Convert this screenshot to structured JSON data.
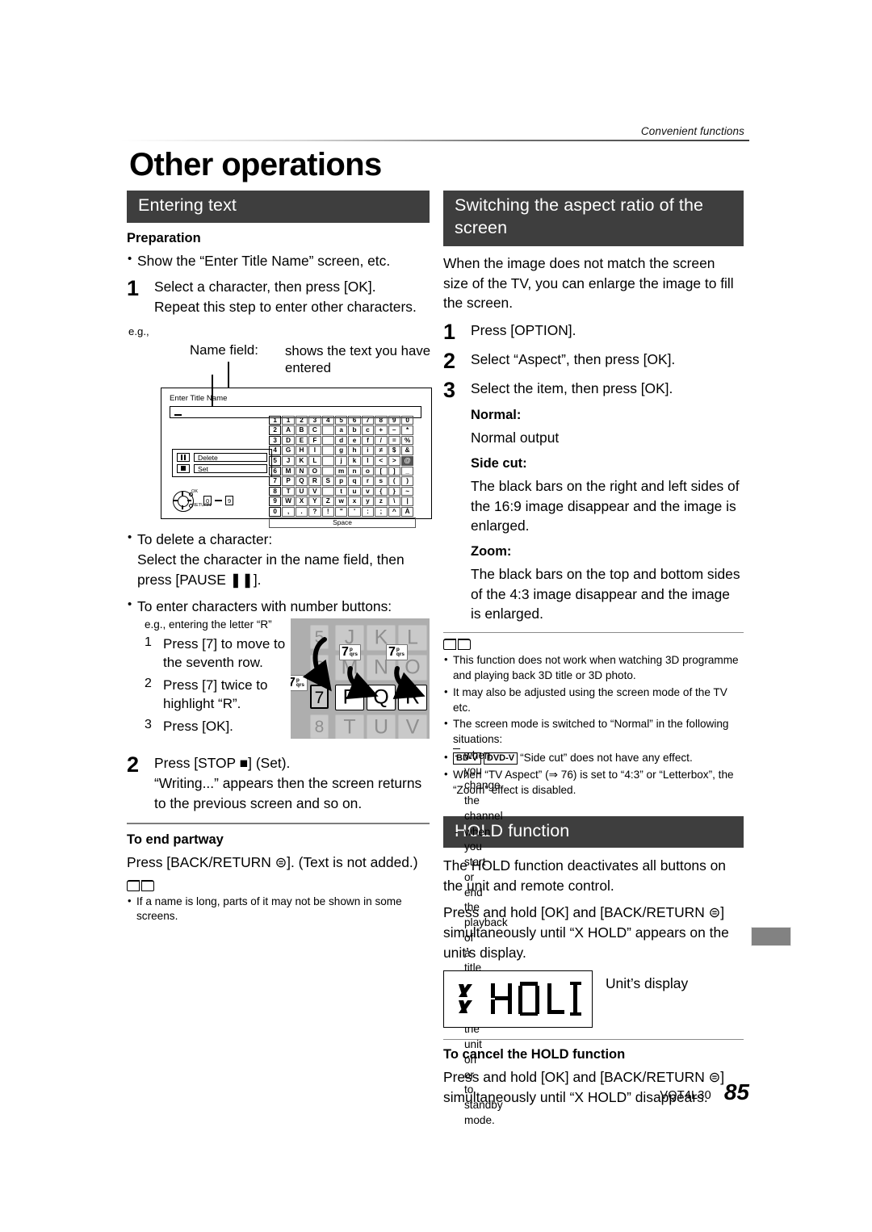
{
  "running_header": "Convenient functions",
  "page_title": "Other operations",
  "left": {
    "section_title": "Entering text",
    "preparation_heading": "Preparation",
    "preparation_items": [
      "Show the “Enter Title Name” screen, etc."
    ],
    "step1": {
      "number": "1",
      "line1": "Select a character, then press [OK].",
      "line2": "Repeat this step to enter other characters."
    },
    "eg_label": "e.g.,",
    "callout": {
      "name_field": "Name field:",
      "description": "shows the text you have entered"
    },
    "osd": {
      "title": "Enter Title Name",
      "commands": [
        {
          "icon": "pause-icon",
          "label": "Delete"
        },
        {
          "icon": "stop-icon",
          "label": "Set"
        }
      ],
      "dial_ok": "OK",
      "dial_return": "RETURN",
      "num_from": "0",
      "num_to": "9",
      "space_label": "Space",
      "grid_rows": [
        [
          "1",
          "1",
          "2",
          "3",
          "4",
          "5",
          "6",
          "7",
          "8",
          "9",
          "0"
        ],
        [
          "2",
          "A",
          "B",
          "C",
          "",
          "a",
          "b",
          "c",
          "+",
          "–",
          "*"
        ],
        [
          "3",
          "D",
          "E",
          "F",
          "",
          "d",
          "e",
          "f",
          "/",
          "=",
          "%"
        ],
        [
          "4",
          "G",
          "H",
          "I",
          "",
          "g",
          "h",
          "i",
          "≠",
          "$",
          "&"
        ],
        [
          "5",
          "J",
          "K",
          "L",
          "",
          "j",
          "k",
          "l",
          "<",
          ">",
          "@"
        ],
        [
          "6",
          "M",
          "N",
          "O",
          "",
          "m",
          "n",
          "o",
          "[",
          "]",
          "_"
        ],
        [
          "7",
          "P",
          "Q",
          "R",
          "S",
          "p",
          "q",
          "r",
          "s",
          "(",
          ")"
        ],
        [
          "8",
          "T",
          "U",
          "V",
          "",
          "t",
          "u",
          "v",
          "{",
          "}",
          "~"
        ],
        [
          "9",
          "W",
          "X",
          "Y",
          "Z",
          "w",
          "x",
          "y",
          "z",
          "\\",
          "|"
        ],
        [
          "0",
          ",",
          ".",
          "?",
          "!",
          "\"",
          "'",
          ":",
          ";",
          "^",
          "À"
        ]
      ],
      "selected_cell": {
        "row": 4,
        "col": 10
      }
    },
    "bullets": [
      {
        "heading": "To delete a character:",
        "body": "Select the character in the name field, then press [PAUSE ❚❚]."
      },
      {
        "heading": "To enter characters with number buttons:"
      }
    ],
    "eg_letter": "e.g., entering the letter “R”",
    "ministeps": [
      {
        "n": "1",
        "t": "Press [7] to move to the seventh row."
      },
      {
        "n": "2",
        "t": "Press [7] twice to highlight “R”."
      },
      {
        "n": "3",
        "t": "Press [OK]."
      }
    ],
    "keypad": {
      "rows": [
        {
          "num": "5",
          "keys": [
            "J",
            "K",
            "L"
          ]
        },
        {
          "num": "6",
          "keys": [
            "M",
            "N",
            "O"
          ]
        },
        {
          "num": "7",
          "keys": [
            "P",
            "Q",
            "R"
          ]
        },
        {
          "num": "8",
          "keys": [
            "T",
            "U",
            "V"
          ]
        }
      ],
      "highlight_row_num": "7",
      "highlight_keys": [
        "P",
        "Q",
        "R"
      ],
      "tag_digit": "7",
      "tag_sup_top": "p",
      "tag_sup_bottom": "qrs",
      "tag_count": 3
    },
    "step2": {
      "number": "2",
      "line1": "Press [STOP ■] (Set).",
      "line2": "“Writing...” appears then the screen returns to the previous screen and so on."
    },
    "end_partway": {
      "heading": "To end partway",
      "body": "Press [BACK/RETURN ⊜]. (Text is not added.)"
    },
    "notes": [
      "If a name is long, parts of it may not be shown in some screens."
    ]
  },
  "right": {
    "aspect": {
      "section_title": "Switching the aspect ratio of the screen",
      "intro": "When the image does not match the screen size of the TV, you can enlarge the image to fill the screen.",
      "steps": [
        {
          "n": "1",
          "t": "Press [OPTION]."
        },
        {
          "n": "2",
          "t": "Select “Aspect”, then press [OK]."
        },
        {
          "n": "3",
          "t": "Select the item, then press [OK]."
        }
      ],
      "items": [
        {
          "term": "Normal:",
          "desc": "Normal output"
        },
        {
          "term": "Side cut:",
          "desc": "The black bars on the right and left sides of the 16:9 image disappear and the image is enlarged."
        },
        {
          "term": "Zoom:",
          "desc": "The black bars on the top and bottom sides of the 4:3 image disappear and the image is enlarged."
        }
      ],
      "notes": [
        {
          "text": "This function does not work when watching 3D programme and playing back 3D title or 3D photo."
        },
        {
          "text": "It may also be adjusted using the screen mode of the TV etc."
        },
        {
          "text": "The screen mode is switched to “Normal” in the following situations:",
          "sub": [
            "when you change the channel",
            "when you start or end the playback of a title",
            "when you switch the unit on or to standby mode."
          ]
        },
        {
          "tags": [
            "BD-V",
            "DVD-V"
          ],
          "text": "“Side cut” does not have any effect."
        },
        {
          "text": "When “TV Aspect” (⇒ 76) is set to “4:3” or “Letterbox”, the “Zoom” effect is disabled."
        }
      ]
    },
    "hold": {
      "section_title": "HOLD function",
      "para1": "The HOLD function deactivates all buttons on the unit and remote control.",
      "para2": "Press and hold [OK] and [BACK/RETURN ⊜] simultaneously until “X HOLD” appears on the unit’s display.",
      "display_text": "X HOLD",
      "display_label": "Unit’s display",
      "cancel_heading": "To cancel the HOLD function",
      "cancel_body": "Press and hold [OK] and [BACK/RETURN ⊜] simultaneously until “X HOLD” disappears."
    }
  },
  "footer": {
    "doc_code": "VQT4L30",
    "page_number": "85"
  },
  "colors": {
    "section_bar": "#3e3e3e",
    "tab_marker": "#828282",
    "keypad_bg": "#aeaeae"
  }
}
